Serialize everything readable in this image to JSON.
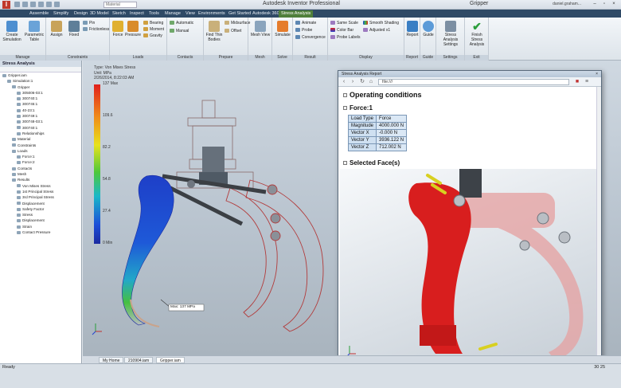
{
  "window": {
    "app_title": "Autodesk Inventor Professional",
    "doc_title": "Gripper",
    "qat_select": "Material",
    "user": "daniel.graham...",
    "controls": [
      "–",
      "▫",
      "×"
    ]
  },
  "tabs": [
    {
      "label": "Assemble"
    },
    {
      "label": "Simplify"
    },
    {
      "label": "Design"
    },
    {
      "label": "3D Model"
    },
    {
      "label": "Sketch"
    },
    {
      "label": "Inspect"
    },
    {
      "label": "Tools"
    },
    {
      "label": "Manage"
    },
    {
      "label": "View"
    },
    {
      "label": "Environments"
    },
    {
      "label": "Get Started"
    },
    {
      "label": "Autodesk 360"
    },
    {
      "label": "Stress Analysis"
    }
  ],
  "ribbon": {
    "panels": [
      {
        "label": "Manage"
      },
      {
        "label": "Constraints"
      },
      {
        "label": "Loads"
      },
      {
        "label": "Contacts"
      },
      {
        "label": "Prepare"
      },
      {
        "label": "Mesh"
      },
      {
        "label": "Solve"
      },
      {
        "label": "Result"
      },
      {
        "label": "Display"
      },
      {
        "label": "Report"
      },
      {
        "label": "Guide"
      },
      {
        "label": "Settings"
      },
      {
        "label": "Exit"
      }
    ],
    "buttons": {
      "create_simulation": "Create Simulation",
      "parametric_table": "Parametric Table",
      "assign": "Assign",
      "fixed": "Fixed",
      "pin": "Pin",
      "frictionless": "Frictionless",
      "force": "Force",
      "pressure": "Pressure",
      "bearing": "Bearing",
      "moment": "Moment",
      "gravity": "Gravity",
      "automatic": "Automatic",
      "manual": "Manual",
      "find_thin_bodies": "Find Thin Bodies",
      "midsurface": "Midsurface",
      "offset": "Offset",
      "mesh_view": "Mesh View",
      "simulate": "Simulate",
      "animate": "Animate",
      "probe": "Probe",
      "convergence": "Convergence",
      "same_scale": "Same Scale",
      "color_bar": "Color Bar",
      "probe_labels": "Probe Labels",
      "smooth_shading": "Smooth Shading",
      "adjusted": "Adjusted x1",
      "report": "Report",
      "guide": "Guide",
      "settings": "Stress Analysis Settings",
      "finish": "Finish Stress Analysis"
    }
  },
  "browser_panel": {
    "title": "Stress Analysis",
    "tree": [
      {
        "label": "Gripper.iam",
        "level": 0
      },
      {
        "label": "Simulation:1",
        "level": 1
      },
      {
        "label": "Gripper",
        "level": 2
      },
      {
        "label": "305006-03:1",
        "level": 3
      },
      {
        "label": "300740:1",
        "level": 3
      },
      {
        "label": "300745:1",
        "level": 3
      },
      {
        "label": "40-23:1",
        "level": 3
      },
      {
        "label": "300749:1",
        "level": 3
      },
      {
        "label": "300748-03:1",
        "level": 3
      },
      {
        "label": "300740:1",
        "level": 3
      },
      {
        "label": "Relationships",
        "level": 3
      },
      {
        "label": "Material",
        "level": 2
      },
      {
        "label": "Constraints",
        "level": 2
      },
      {
        "label": "Loads",
        "level": 2
      },
      {
        "label": "Force:1",
        "level": 3
      },
      {
        "label": "Force:2",
        "level": 3
      },
      {
        "label": "Contacts",
        "level": 2
      },
      {
        "label": "Mesh",
        "level": 2
      },
      {
        "label": "Results",
        "level": 2
      },
      {
        "label": "Von Mises Stress",
        "level": 3
      },
      {
        "label": "1st Principal Stress",
        "level": 3
      },
      {
        "label": "3rd Principal Stress",
        "level": 3
      },
      {
        "label": "Displacement",
        "level": 3
      },
      {
        "label": "Safety Factor",
        "level": 3
      },
      {
        "label": "Stress",
        "level": 3
      },
      {
        "label": "Displacement",
        "level": 3
      },
      {
        "label": "Strain",
        "level": 3
      },
      {
        "label": "Contact Pressure",
        "level": 3
      }
    ]
  },
  "viewport": {
    "legend_lines": [
      "Type: Von Mises Stress",
      "Unit: MPa",
      "2/26/2014, 8:22:03 AM"
    ],
    "legend_max": "137 Max",
    "legend_ticks": [
      "109.6",
      "82.2",
      "54.8",
      "27.4",
      "0 Min"
    ],
    "probe_label": "Max: 137 MPa",
    "colors": {
      "high": "#e0201c",
      "low": "#1b2aa0",
      "part": "#d12020"
    }
  },
  "report": {
    "window_title": "Stress Analysis Report",
    "address": "file:///",
    "heading": "Operating conditions",
    "force_heading": "Force:1",
    "faces_heading": "Selected Face(s)",
    "table": [
      [
        "Load Type",
        "Force"
      ],
      [
        "Magnitude",
        "4000.000 N"
      ],
      [
        "Vector X",
        "-0.000 N"
      ],
      [
        "Vector Y",
        "3936.122 N"
      ],
      [
        "Vector Z",
        "712.002 N"
      ]
    ]
  },
  "doc_tabs": [
    "My Home",
    "210904.iam",
    "Gripper.iam"
  ],
  "status": {
    "text": "Ready",
    "numbers": "30   25"
  }
}
